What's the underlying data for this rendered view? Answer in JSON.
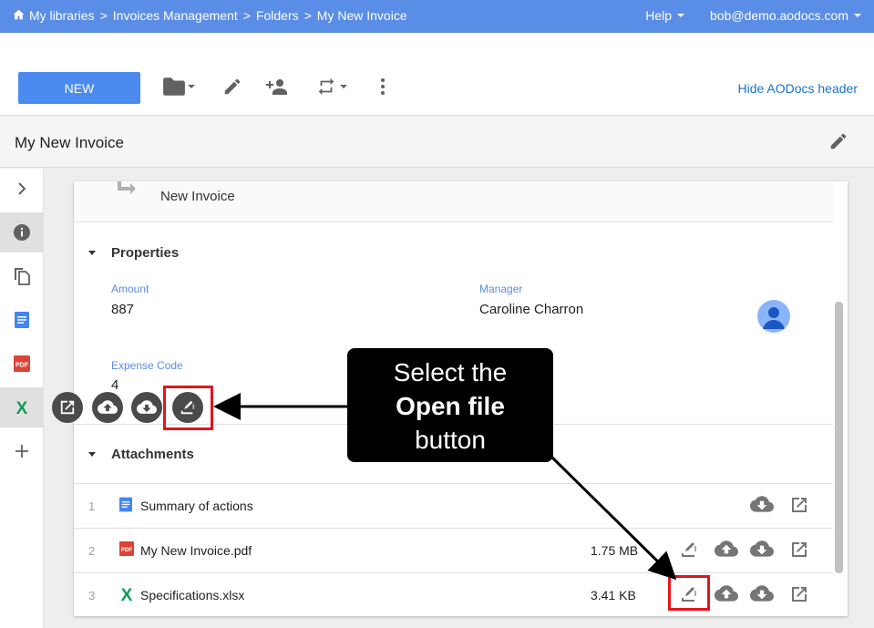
{
  "topbar": {
    "breadcrumbs": [
      "My libraries",
      "Invoices Management",
      "Folders",
      "My New Invoice"
    ],
    "separator": ">",
    "help": "Help",
    "user": "bob@demo.aodocs.com"
  },
  "toolbar": {
    "new_label": "NEW",
    "hide_header": "Hide AODocs header"
  },
  "document": {
    "title": "My New Invoice",
    "header_name": "New Invoice"
  },
  "properties": {
    "section_title": "Properties",
    "amount_label": "Amount",
    "amount_value": "887",
    "manager_label": "Manager",
    "manager_value": "Caroline Charron",
    "expense_label": "Expense Code",
    "expense_value": "4"
  },
  "attachments": {
    "section_title": "Attachments",
    "rows": [
      {
        "num": "1",
        "name": "Summary of actions",
        "size": "",
        "type": "gdoc"
      },
      {
        "num": "2",
        "name": "My New Invoice.pdf",
        "size": "1.75 MB",
        "type": "pdf"
      },
      {
        "num": "3",
        "name": "Specifications.xlsx",
        "size": "3.41 KB",
        "type": "xlsx"
      }
    ]
  },
  "callout": {
    "line1": "Select the",
    "line2": "Open file",
    "line3": "button"
  },
  "colors": {
    "topbar": "#5a8de6",
    "new_button": "#4b8bf0",
    "link": "#1a73c8",
    "highlight": "#e0161b",
    "label": "#5a8de6"
  },
  "icons": {
    "rail": [
      "chevron-right-icon",
      "info-icon",
      "copy-icon",
      "gdoc-icon",
      "pdf-icon",
      "excel-icon",
      "plus-icon"
    ],
    "fab": [
      "open-external-icon",
      "upload-icon",
      "download-icon",
      "open-file-icon"
    ]
  }
}
